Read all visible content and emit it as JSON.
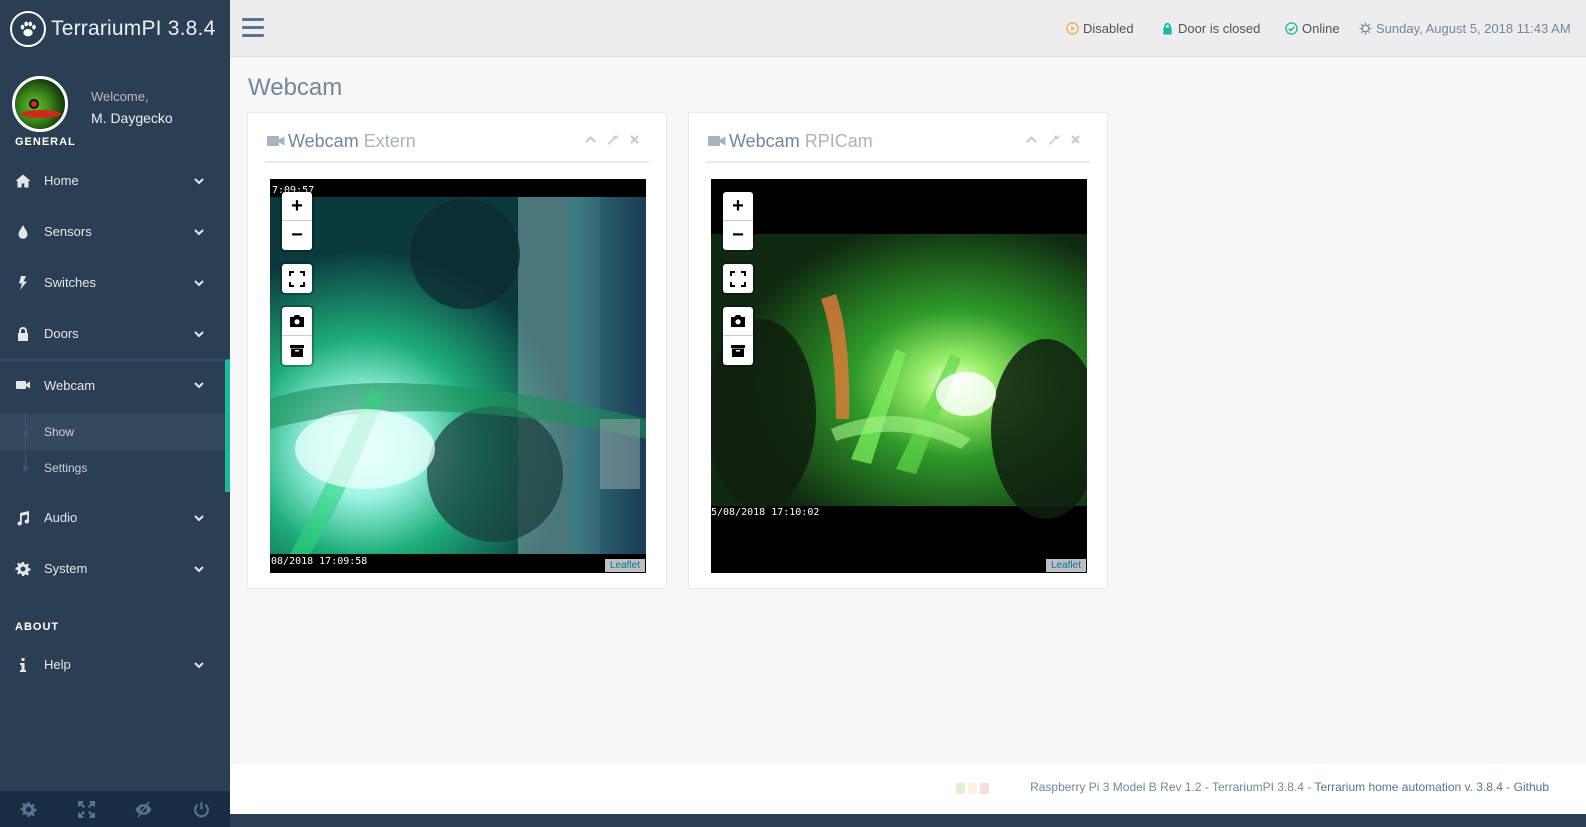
{
  "app": {
    "title": "TerrariumPI 3.8.4"
  },
  "profile": {
    "welcome": "Welcome,",
    "name": "M. Daygecko"
  },
  "sidebar": {
    "general_title": "GENERAL",
    "about_title": "ABOUT",
    "items": [
      {
        "label": "Home",
        "icon": "home-icon"
      },
      {
        "label": "Sensors",
        "icon": "tint-icon"
      },
      {
        "label": "Switches",
        "icon": "bolt-icon"
      },
      {
        "label": "Doors",
        "icon": "lock-icon"
      },
      {
        "label": "Webcam",
        "icon": "video-camera-icon"
      },
      {
        "label": "Audio",
        "icon": "music-icon"
      },
      {
        "label": "System",
        "icon": "gear-icon"
      },
      {
        "label": "Help",
        "icon": "info-icon"
      }
    ],
    "webcam_submenu": [
      "Show",
      "Settings"
    ]
  },
  "topbar": {
    "state": "Disabled",
    "door": "Door is closed",
    "online": "Online",
    "datetime": "Sunday, August 5, 2018 11:43 AM",
    "colors": {
      "disabled": "#F0AD4E",
      "door": "#1ABB9C",
      "online": "#26B99A"
    }
  },
  "page": {
    "title": "Webcam"
  },
  "webcams": [
    {
      "title_main": "Webcam",
      "title_sub": "Extern",
      "timestamp_top": "7:09:57",
      "timestamp_bottom": "08/2018 17:09:58",
      "attribution": "Leaflet"
    },
    {
      "title_main": "Webcam",
      "title_sub": "RPICam",
      "timestamp_bottom": "5/08/2018 17:10:02",
      "attribution": "Leaflet"
    }
  ],
  "footer": {
    "text": "Raspberry Pi 3 Model B Rev 1.2 - TerrariumPI 3.8.4 - ",
    "link": "Terrarium home automation v. 3.8.4 - Github"
  }
}
